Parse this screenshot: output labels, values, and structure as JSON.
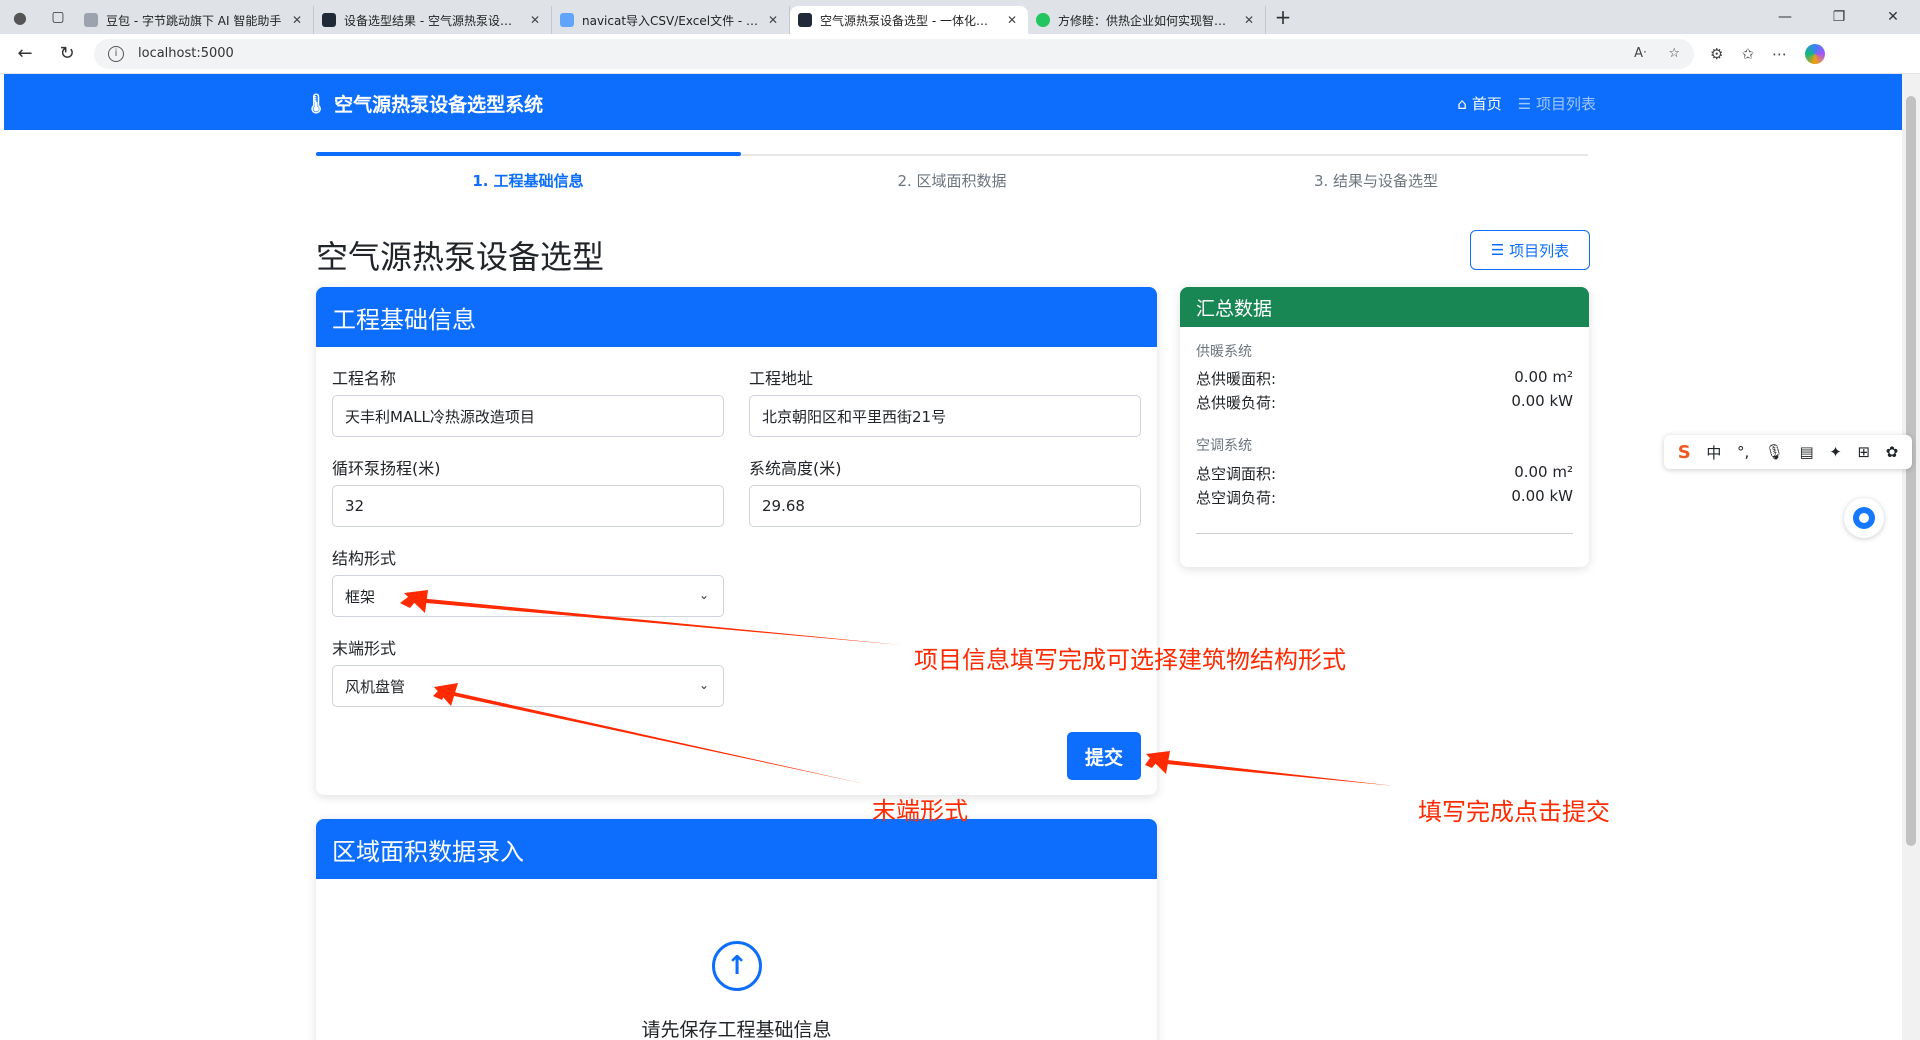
{
  "browser": {
    "tabs": [
      {
        "title": "豆包 - 字节跳动旗下 AI 智能助手",
        "favicon_color": "#6b7280",
        "active": false
      },
      {
        "title": "设备选型结果 - 空气源热泵设备选型",
        "favicon_color": "#1f2937",
        "active": false
      },
      {
        "title": "navicat导入CSV/Excel文件 - 知乎",
        "favicon_color": "#60a5fa",
        "active": false
      },
      {
        "title": "空气源热泵设备选型 - 一体化数据",
        "favicon_color": "#1f2937",
        "active": true
      },
      {
        "title": "方修睦：供热企业如何实现智慧供热",
        "favicon_color": "#22c55e",
        "active": false
      }
    ],
    "url": "localhost:5000"
  },
  "navbar": {
    "brand": "空气源热泵设备选型系统",
    "home": "首页",
    "project_list": "项目列表"
  },
  "steps": {
    "step1": "1. 工程基础信息",
    "step2": "2. 区域面积数据",
    "step3": "3. 结果与设备选型"
  },
  "page": {
    "title": "空气源热泵设备选型",
    "project_list_button": "项目列表"
  },
  "basic_info": {
    "header": "工程基础信息",
    "project_name_label": "工程名称",
    "project_name_value": "天丰利MALL冷热源改造项目",
    "address_label": "工程地址",
    "address_value": "北京朝阳区和平里西街21号",
    "pump_head_label": "循环泵扬程(米)",
    "pump_head_value": "32",
    "system_height_label": "系统高度(米)",
    "system_height_value": "29.68",
    "structure_label": "结构形式",
    "structure_value": "框架",
    "terminal_label": "末端形式",
    "terminal_value": "风机盘管",
    "submit": "提交"
  },
  "summary": {
    "header": "汇总数据",
    "heating_section": "供暖系统",
    "heating_area_label": "总供暖面积:",
    "heating_area_value": "0.00 m²",
    "heating_load_label": "总供暖负荷:",
    "heating_load_value": "0.00 kW",
    "ac_section": "空调系统",
    "ac_area_label": "总空调面积:",
    "ac_area_value": "0.00 m²",
    "ac_load_label": "总空调负荷:",
    "ac_load_value": "0.00 kW"
  },
  "area_data": {
    "header": "区域面积数据录入",
    "prompt": "请先保存工程基础信息"
  },
  "annotations": {
    "structure_note": "项目信息填写完成可选择建筑物结构形式",
    "terminal_note": "末端形式",
    "submit_note": "填写完成点击提交"
  },
  "colors": {
    "primary": "#0d6efd",
    "success": "#198754",
    "annotation": "#ff2a00"
  }
}
